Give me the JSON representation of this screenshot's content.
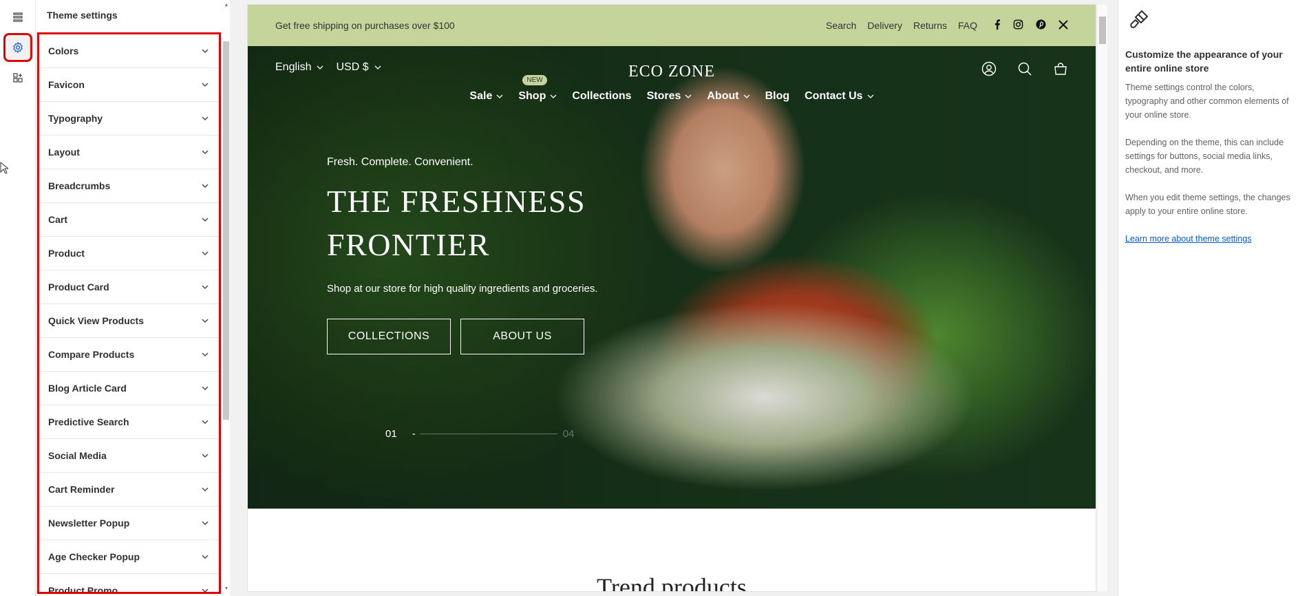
{
  "app": {
    "rail": {
      "items": [
        {
          "icon": "sections-icon"
        },
        {
          "icon": "gear-icon",
          "active": true
        },
        {
          "icon": "apps-icon"
        }
      ]
    }
  },
  "settings": {
    "title": "Theme settings",
    "items": [
      {
        "label": "Colors"
      },
      {
        "label": "Favicon"
      },
      {
        "label": "Typography"
      },
      {
        "label": "Layout"
      },
      {
        "label": "Breadcrumbs"
      },
      {
        "label": "Cart"
      },
      {
        "label": "Product"
      },
      {
        "label": "Product Card"
      },
      {
        "label": "Quick View Products"
      },
      {
        "label": "Compare Products"
      },
      {
        "label": "Blog Article Card"
      },
      {
        "label": "Predictive Search"
      },
      {
        "label": "Social Media"
      },
      {
        "label": "Cart Reminder"
      },
      {
        "label": "Newsletter Popup"
      },
      {
        "label": "Age Checker Popup"
      },
      {
        "label": "Product Promo"
      }
    ]
  },
  "preview": {
    "announcement": {
      "text": "Get free shipping on purchases over $100",
      "links": [
        "Search",
        "Delivery",
        "Returns",
        "FAQ"
      ],
      "social": [
        "facebook-icon",
        "instagram-icon",
        "pinterest-icon",
        "x-icon"
      ],
      "bg_color": "#c5d49a"
    },
    "header": {
      "language": "English",
      "currency": "USD $",
      "logo": "ECO ZONE",
      "icons": [
        "account-icon",
        "search-icon",
        "cart-icon"
      ],
      "nav": [
        {
          "label": "Sale",
          "dropdown": true
        },
        {
          "label": "Shop",
          "dropdown": true,
          "badge": "NEW"
        },
        {
          "label": "Collections",
          "dropdown": false
        },
        {
          "label": "Stores",
          "dropdown": true
        },
        {
          "label": "About",
          "dropdown": true
        },
        {
          "label": "Blog",
          "dropdown": false
        },
        {
          "label": "Contact Us",
          "dropdown": true
        }
      ]
    },
    "hero": {
      "kicker": "Fresh. Complete. Convenient.",
      "title": "THE FRESHNESS FRONTIER",
      "subtitle": "Shop at our store for high quality ingredients and groceries.",
      "buttons": [
        "COLLECTIONS",
        "ABOUT US"
      ],
      "slide_current": "01",
      "slide_separator": "-",
      "slide_total": "04"
    },
    "next_section_title": "Trend products"
  },
  "info": {
    "icon": "paintbrush-icon",
    "title": "Customize the appearance of your entire online store",
    "paragraphs": [
      "Theme settings control the colors, typography and other common elements of your online store.",
      "Depending on the theme, this can include settings for buttons, social media links, checkout, and more.",
      "When you edit theme settings, the changes apply to your entire online store."
    ],
    "link": "Learn more about theme settings",
    "link_color": "#005bd3"
  },
  "colors": {
    "highlight": "#e00000",
    "accent": "#c5d49a"
  }
}
